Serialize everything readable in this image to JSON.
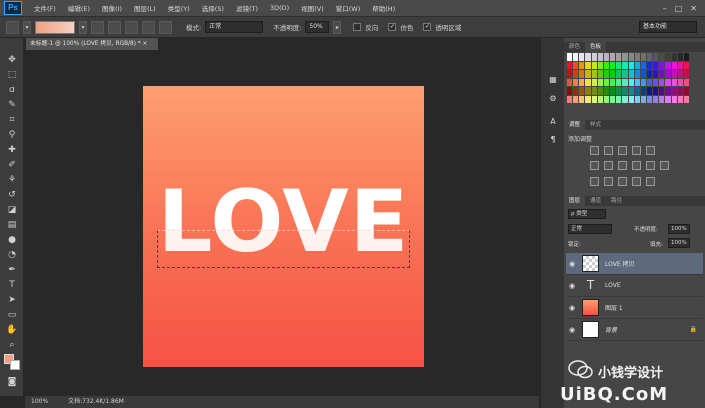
{
  "app": {
    "logo": "Ps"
  },
  "menu": [
    "文件(F)",
    "编辑(E)",
    "图像(I)",
    "图层(L)",
    "类型(Y)",
    "选择(S)",
    "滤镜(T)",
    "3D(D)",
    "视图(V)",
    "窗口(W)",
    "帮助(H)"
  ],
  "window_buttons": [
    "–",
    "□",
    "✕"
  ],
  "options": {
    "mode_label": "模式:",
    "mode_value": "正常",
    "opacity_label": "不透明度:",
    "opacity_value": "50%",
    "reverse_label": "反向",
    "dither_label": "仿色",
    "transparency_label": "透明区域",
    "workspace": "基本功能"
  },
  "document": {
    "tab_title": "未标题-1 @ 100% (LOVE 拷贝, RGB/8) * ×",
    "canvas_text": "LOVE",
    "zoom": "100%",
    "doc_info": "文档:732.4K/1.86M"
  },
  "swatches_panel": {
    "tabs": [
      "颜色",
      "色板"
    ]
  },
  "adjustments_panel": {
    "tabs": [
      "调整",
      "样式"
    ],
    "title": "添加调整"
  },
  "layers_panel": {
    "tabs": [
      "图层",
      "通道",
      "路径"
    ],
    "filter": "ρ 类型",
    "blend_mode": "正常",
    "opacity_label": "不透明度:",
    "opacity_value": "100%",
    "lock_label": "锁定:",
    "fill_label": "填充:",
    "fill_value": "100%",
    "layers": [
      {
        "name": "LOVE 拷贝",
        "type": "raster-copy",
        "selected": true
      },
      {
        "name": "LOVE",
        "type": "text",
        "selected": false
      },
      {
        "name": "图层 1",
        "type": "gradient",
        "selected": false
      },
      {
        "name": "背景",
        "type": "background",
        "selected": false,
        "locked": true
      }
    ]
  },
  "watermark": {
    "text": "小钱学设计",
    "url": "UiBQ.CoM"
  },
  "colors": {
    "accent": "#31a8ff",
    "canvas_top": "#fd9f6e",
    "canvas_bottom": "#f55146"
  }
}
